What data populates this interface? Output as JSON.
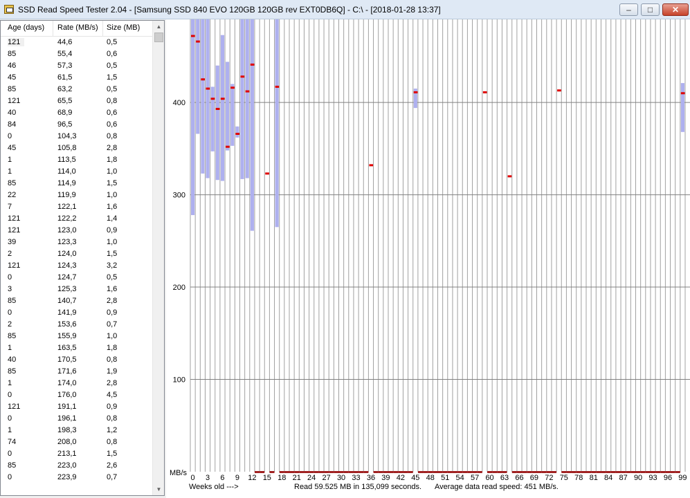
{
  "window": {
    "title": "SSD Read Speed Tester 2.04 - [Samsung SSD 840 EVO 120GB 120GB rev EXT0DB6Q] - C:\\ - [2018-01-28 13:37]",
    "buttons": {
      "minimize": "–",
      "maximize": "□",
      "close": "✕"
    },
    "icon": "app-disk-icon"
  },
  "list": {
    "columns": [
      "Age (days)",
      "Rate (MB/s)",
      "Size (MB)"
    ],
    "rows": [
      [
        "121",
        "44,6",
        "0,5"
      ],
      [
        "85",
        "55,4",
        "0,6"
      ],
      [
        "46",
        "57,3",
        "0,5"
      ],
      [
        "45",
        "61,5",
        "1,5"
      ],
      [
        "85",
        "63,2",
        "0,5"
      ],
      [
        "121",
        "65,5",
        "0,8"
      ],
      [
        "40",
        "68,9",
        "0,6"
      ],
      [
        "84",
        "96,5",
        "0,6"
      ],
      [
        "0",
        "104,3",
        "0,8"
      ],
      [
        "45",
        "105,8",
        "2,8"
      ],
      [
        "1",
        "113,5",
        "1,8"
      ],
      [
        "1",
        "114,0",
        "1,0"
      ],
      [
        "85",
        "114,9",
        "1,5"
      ],
      [
        "22",
        "119,9",
        "1,0"
      ],
      [
        "7",
        "122,1",
        "1,6"
      ],
      [
        "121",
        "122,2",
        "1,4"
      ],
      [
        "121",
        "123,0",
        "0,9"
      ],
      [
        "39",
        "123,3",
        "1,0"
      ],
      [
        "2",
        "124,0",
        "1,5"
      ],
      [
        "121",
        "124,3",
        "3,2"
      ],
      [
        "0",
        "124,7",
        "0,5"
      ],
      [
        "3",
        "125,3",
        "1,6"
      ],
      [
        "85",
        "140,7",
        "2,8"
      ],
      [
        "0",
        "141,9",
        "0,9"
      ],
      [
        "2",
        "153,6",
        "0,7"
      ],
      [
        "85",
        "155,9",
        "1,0"
      ],
      [
        "1",
        "163,5",
        "1,8"
      ],
      [
        "40",
        "170,5",
        "0,8"
      ],
      [
        "85",
        "171,6",
        "1,9"
      ],
      [
        "1",
        "174,0",
        "2,8"
      ],
      [
        "0",
        "176,0",
        "4,5"
      ],
      [
        "121",
        "191,1",
        "0,9"
      ],
      [
        "0",
        "196,1",
        "0,8"
      ],
      [
        "1",
        "198,3",
        "1,2"
      ],
      [
        "74",
        "208,0",
        "0,8"
      ],
      [
        "0",
        "213,1",
        "1,5"
      ],
      [
        "85",
        "223,0",
        "2,6"
      ],
      [
        "0",
        "223,9",
        "0,7"
      ]
    ],
    "scroll_up_icon": "▲",
    "scroll_down_icon": "▼"
  },
  "graph": {
    "y_unit_label": "MB/s",
    "x_axis_label": "Weeks old --->",
    "status_read": "Read 59.525 MB in 135,099 seconds.",
    "status_avg": "Average data read speed: 451 MB/s.",
    "colors": {
      "range_bar": "#aeb0ef",
      "mean_marker": "#e00000",
      "zero_marker": "#a02020",
      "grid": "#808080",
      "week_line": "#a0a0a0"
    }
  },
  "chart_data": {
    "type": "bar",
    "title": "",
    "xlabel": "Weeks old --->",
    "ylabel": "MB/s",
    "ylim": [
      0,
      490
    ],
    "xlim": [
      0,
      100
    ],
    "y_ticks": [
      100,
      200,
      300,
      400
    ],
    "x_ticks": [
      0,
      3,
      6,
      9,
      12,
      15,
      18,
      21,
      24,
      27,
      30,
      33,
      36,
      39,
      42,
      45,
      48,
      51,
      54,
      57,
      60,
      63,
      66,
      69,
      72,
      75,
      78,
      81,
      84,
      87,
      90,
      93,
      96,
      99
    ],
    "grid": true,
    "series": [
      {
        "values": [
          {
            "week": 0,
            "low": 278,
            "high": 490,
            "avg": 472
          },
          {
            "week": 1,
            "low": 366,
            "high": 490,
            "avg": 466
          },
          {
            "week": 2,
            "low": 323,
            "high": 490,
            "avg": 425
          },
          {
            "week": 3,
            "low": 318,
            "high": 490,
            "avg": 415
          },
          {
            "week": 4,
            "low": 347,
            "high": 417,
            "avg": 404
          },
          {
            "week": 5,
            "low": 316,
            "high": 440,
            "avg": 393
          },
          {
            "week": 6,
            "low": 315,
            "high": 473,
            "avg": 404
          },
          {
            "week": 7,
            "low": 348,
            "high": 444,
            "avg": 352
          },
          {
            "week": 8,
            "low": 353,
            "high": 420,
            "avg": 416
          },
          {
            "week": 9,
            "low": 362,
            "high": 374,
            "avg": 366
          },
          {
            "week": 10,
            "low": 317,
            "high": 490,
            "avg": 428
          },
          {
            "week": 11,
            "low": 318,
            "high": 490,
            "avg": 412
          },
          {
            "week": 12,
            "low": 261,
            "high": 490,
            "avg": 441
          },
          {
            "week": 15,
            "low": 323,
            "high": 323,
            "avg": 323
          },
          {
            "week": 17,
            "low": 265,
            "high": 490,
            "avg": 417
          },
          {
            "week": 36,
            "low": 332,
            "high": 332,
            "avg": 332
          },
          {
            "week": 45,
            "low": 394,
            "high": 415,
            "avg": 411
          },
          {
            "week": 59,
            "low": 411,
            "high": 411,
            "avg": 411
          },
          {
            "week": 64,
            "low": 320,
            "high": 320,
            "avg": 320
          },
          {
            "week": 74,
            "low": 413,
            "high": 413,
            "avg": 413
          },
          {
            "week": 99,
            "low": 368,
            "high": 421,
            "avg": 410
          }
        ]
      }
    ]
  }
}
